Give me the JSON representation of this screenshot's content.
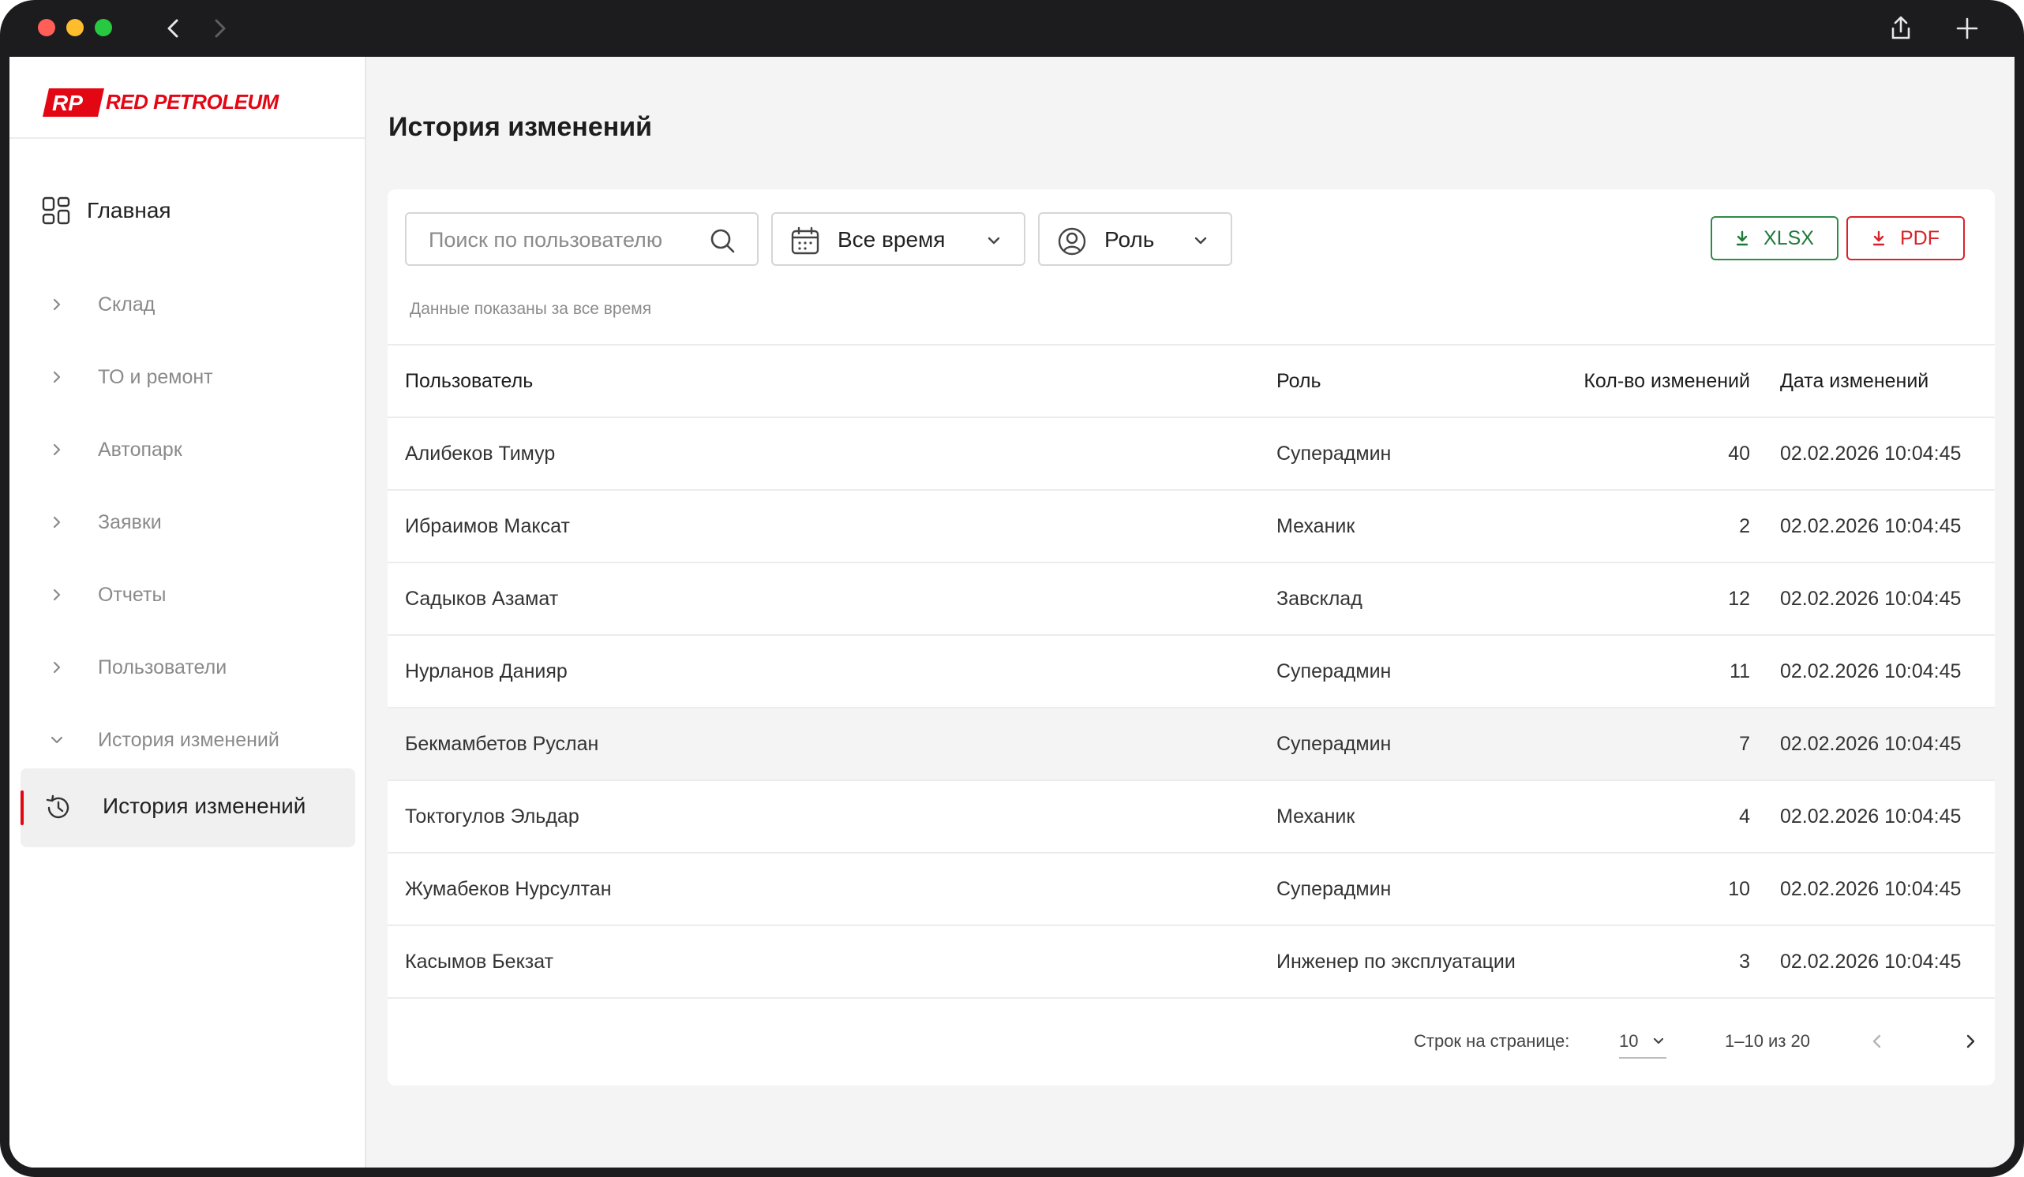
{
  "brand": {
    "logo_mark": "RP",
    "name": "RED PETROLEUM",
    "color": "#e30613"
  },
  "sidebar": {
    "home": {
      "label": "Главная",
      "icon": "dashboard-icon"
    },
    "items": [
      {
        "label": "Склад",
        "icon": "chevron-right-icon"
      },
      {
        "label": "ТО и ремонт",
        "icon": "chevron-right-icon"
      },
      {
        "label": "Автопарк",
        "icon": "chevron-right-icon"
      },
      {
        "label": "Заявки",
        "icon": "chevron-right-icon"
      },
      {
        "label": "Отчеты",
        "icon": "chevron-right-icon"
      },
      {
        "label": "Пользователи",
        "icon": "chevron-right-icon"
      },
      {
        "label": "История изменений",
        "icon": "chevron-down-icon"
      }
    ],
    "active": {
      "label": "История изменений",
      "icon": "history-icon"
    }
  },
  "page": {
    "title": "История изменений"
  },
  "filters": {
    "search_placeholder": "Поиск по пользователю",
    "period": "Все время",
    "role": "Роль",
    "hint": "Данные показаны за все время"
  },
  "export": {
    "xlsx_label": "XLSX",
    "pdf_label": "PDF",
    "xlsx_color": "#2e8b4a",
    "pdf_color": "#d8232a"
  },
  "table": {
    "headers": {
      "user": "Пользователь",
      "role": "Роль",
      "count": "Кол-во изменений",
      "date": "Дата изменений"
    },
    "rows": [
      {
        "user": "Алибеков Тимур",
        "role": "Суперадмин",
        "count": "40",
        "date": "02.02.2026 10:04:45"
      },
      {
        "user": "Ибраимов Максат",
        "role": "Механик",
        "count": "2",
        "date": "02.02.2026 10:04:45"
      },
      {
        "user": "Садыков Азамат",
        "role": "Завсклад",
        "count": "12",
        "date": "02.02.2026 10:04:45"
      },
      {
        "user": "Нурланов Данияр",
        "role": "Суперадмин",
        "count": "11",
        "date": "02.02.2026 10:04:45"
      },
      {
        "user": "Бекмамбетов Руслан",
        "role": "Суперадмин",
        "count": "7",
        "date": "02.02.2026 10:04:45"
      },
      {
        "user": "Токтогулов Эльдар",
        "role": "Механик",
        "count": "4",
        "date": "02.02.2026 10:04:45"
      },
      {
        "user": "Жумабеков Нурсултан",
        "role": "Суперадмин",
        "count": "10",
        "date": "02.02.2026 10:04:45"
      },
      {
        "user": "Касымов Бекзат",
        "role": "Инженер по эксплуатации",
        "count": "3",
        "date": "02.02.2026 10:04:45"
      }
    ]
  },
  "pagination": {
    "rows_label": "Строк на странице:",
    "rows_per_page": "10",
    "range": "1–10 из 20"
  }
}
